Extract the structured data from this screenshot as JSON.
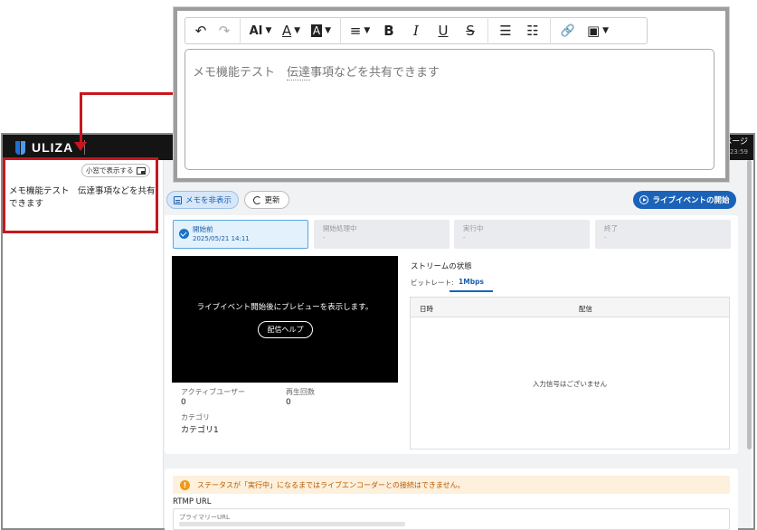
{
  "app": {
    "logo_text": "ULIZA",
    "topbar_right_top": "ページ",
    "topbar_right_bottom": "23:59"
  },
  "memo": {
    "popout_label": "小窓で表示する",
    "text": "メモ機能テスト　伝達事項などを共有できます"
  },
  "editor": {
    "toolbar": {
      "undo": "↶",
      "redo": "↷",
      "font_size": "AI",
      "font_color": "A",
      "highlight": "A",
      "align": "≡",
      "bold": "B",
      "italic": "I",
      "underline": "U",
      "strike": "S",
      "bullet_list": "☰",
      "numbered_list": "☷",
      "link": "🔗",
      "image": "▣"
    },
    "text_part1": "メモ機能テスト　",
    "text_part2": "伝達",
    "text_part3": "事項などを共有できます"
  },
  "actions": {
    "hide_memo": "メモを非表示",
    "refresh": "更新",
    "start_live": "ライブイベントの開始"
  },
  "steps": [
    {
      "label": "開始前",
      "value": "2025/05/21 14:11"
    },
    {
      "label": "開始処理中",
      "value": "-"
    },
    {
      "label": "実行中",
      "value": "-"
    },
    {
      "label": "終了",
      "value": "-"
    }
  ],
  "preview": {
    "message": "ライブイベント開始後にプレビューを表示します。",
    "help_button": "配信ヘルプ"
  },
  "stats": {
    "active_users_label": "アクティブユーザー",
    "active_users_value": "0",
    "plays_label": "再生回数",
    "plays_value": "0",
    "category_label": "カテゴリ",
    "category_value": "カテゴリ1"
  },
  "stream": {
    "title": "ストリームの状態",
    "bitrate_label": "ビットレート:",
    "bitrate_tab": "1Mbps",
    "col_datetime": "日時",
    "col_delivery": "配信",
    "empty": "入力信号はございません"
  },
  "warning": {
    "icon": "!",
    "text": "ステータスが「実行中」になるまではライブエンコーダーとの接続はできません。"
  },
  "rtmp": {
    "label": "RTMP URL",
    "primary_label": "プライマリーURL"
  },
  "colors": {
    "accent": "#1a63b8",
    "highlight_red": "#c8161d",
    "topbar": "#141414",
    "warning_bg": "#fdf0dc"
  }
}
